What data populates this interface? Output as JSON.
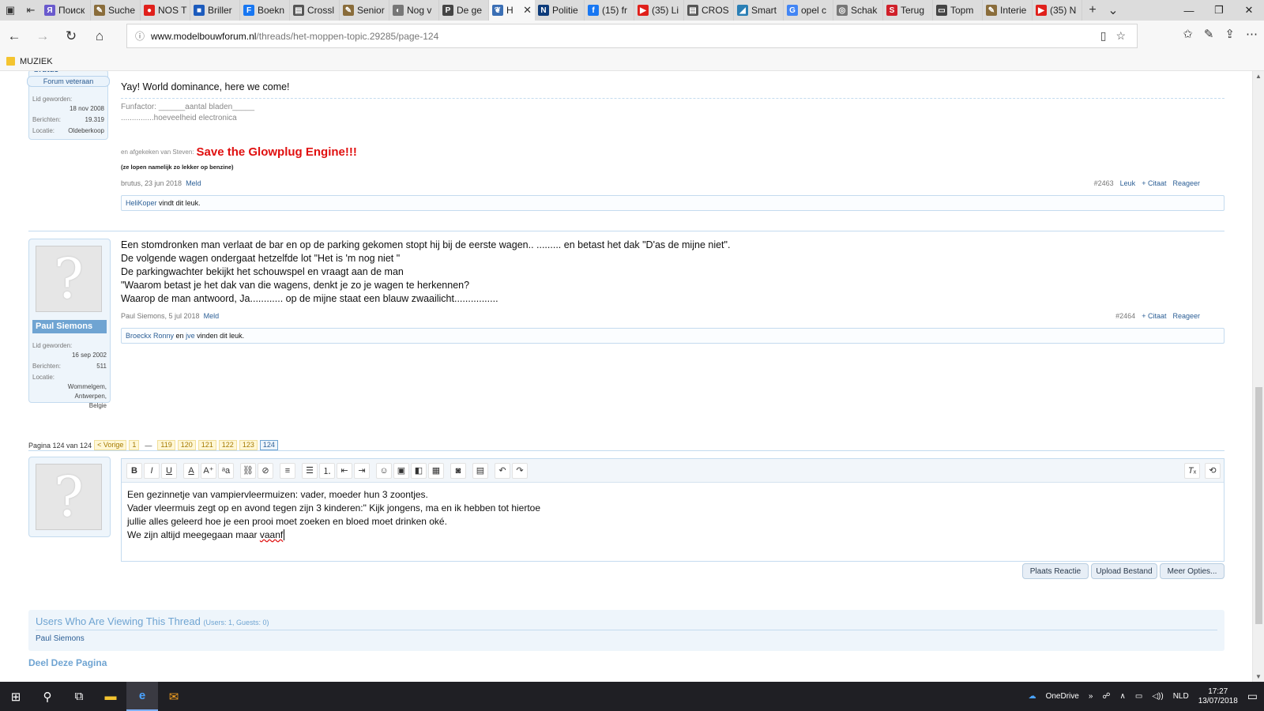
{
  "browser": {
    "tabs": [
      {
        "label": "Поиск",
        "color": "#6a5acd",
        "icon": "Я"
      },
      {
        "label": "Suche",
        "color": "#8a6d3b",
        "icon": "✎"
      },
      {
        "label": "NOS T",
        "color": "#e0201b",
        "icon": "●"
      },
      {
        "label": "Briller",
        "color": "#1c5bbd",
        "icon": "■"
      },
      {
        "label": "Boekn",
        "color": "#1877f2",
        "icon": "F"
      },
      {
        "label": "Crossl",
        "color": "#555555",
        "icon": "▤"
      },
      {
        "label": "Senior",
        "color": "#8a6d3b",
        "icon": "✎"
      },
      {
        "label": "Nog v",
        "color": "#777777",
        "icon": "◐"
      },
      {
        "label": "De ge",
        "color": "#444444",
        "icon": "P"
      },
      {
        "label": "H",
        "color": "#3b6fb5",
        "icon": "❦"
      },
      {
        "label": "Politie",
        "color": "#0d3b7a",
        "icon": "N"
      },
      {
        "label": "(15) fr",
        "color": "#1877f2",
        "icon": "f"
      },
      {
        "label": "(35) Li",
        "color": "#e0201b",
        "icon": "▶"
      },
      {
        "label": "CROS",
        "color": "#555555",
        "icon": "▤"
      },
      {
        "label": "Smart",
        "color": "#2a7fb5",
        "icon": "◢"
      },
      {
        "label": "opel c",
        "color": "#4285f4",
        "icon": "G"
      },
      {
        "label": "Schak",
        "color": "#777777",
        "icon": "◎"
      },
      {
        "label": "Terug",
        "color": "#d0202a",
        "icon": "S"
      },
      {
        "label": "Topm",
        "color": "#444444",
        "icon": "▭"
      },
      {
        "label": "Interie",
        "color": "#8a6d3b",
        "icon": "✎"
      },
      {
        "label": "(35) N",
        "color": "#e0201b",
        "icon": "▶"
      }
    ],
    "active_tab_index": 9,
    "url_domain": "www.modelbouwforum.nl",
    "url_path": "/threads/het-moppen-topic.29285/page-124",
    "favorites": [
      {
        "label": "MUZIEK"
      }
    ]
  },
  "post1": {
    "username_partial": "brutus",
    "role": "Forum veteraan",
    "stats": [
      {
        "label": "Lid geworden:",
        "value": "18 nov 2008"
      },
      {
        "label": "Berichten:",
        "value": "19.319"
      },
      {
        "label": "Locatie:",
        "value": "Oldeberkoop"
      }
    ],
    "message": "Yay! World dominance, here we come!",
    "signature": {
      "funfactor_label": "Funfactor:",
      "funfactor_value": "______aantal bladen_____",
      "funfactor_line2": "...............hoeveelheid electronica",
      "stolen_from": "en afgekeken van Steven:",
      "glowplug": "Save the Glowplug Engine!!!",
      "benzine": "(ze lopen namelijk zo lekker op benzine)"
    },
    "meta_author_date": "brutus, 23 jun 2018",
    "report": "Meld",
    "post_number": "#2463",
    "like": "Leuk",
    "quote": "+ Citaat",
    "reply": "Reageer",
    "liked_by": "HeliKoper",
    "liked_suffix": "vindt dit leuk."
  },
  "post2": {
    "username": "Paul Siemons",
    "stats": [
      {
        "label": "Lid geworden:",
        "value": "16 sep 2002"
      },
      {
        "label": "Berichten:",
        "value": "511"
      },
      {
        "label": "Locatie:",
        "value": "Wommelgem, Antwerpen, Belgie"
      }
    ],
    "lines": [
      "Een stomdronken man verlaat de bar en op de parking gekomen stopt hij bij de eerste wagen.. ......... en betast het dak \"D'as de mijne niet\".",
      "De volgende wagen ondergaat hetzelfde lot \"Het is 'm nog niet \"",
      "De parkingwachter bekijkt het schouwspel en vraagt aan de man",
      "\"Waarom betast je het dak van die wagens, denkt je zo je wagen te herkennen?",
      "Waarop de man antwoord, Ja............ op de mijne staat een blauw zwaailicht................"
    ],
    "meta_author_date": "Paul Siemons, 5 jul 2018",
    "report": "Meld",
    "post_number": "#2464",
    "quote": "+ Citaat",
    "reply": "Reageer",
    "liked_by_1": "Broeckx Ronny",
    "liked_and": "en",
    "liked_by_2": "jve",
    "liked_suffix": "vinden dit leuk."
  },
  "pagination": {
    "label": "Pagina 124 van 124",
    "prev": "< Vorige",
    "first": "1",
    "ellipsis": "—",
    "pages": [
      "119",
      "120",
      "121",
      "122",
      "123"
    ],
    "current": "124"
  },
  "editor": {
    "lines": [
      "Een gezinnetje van vampiervleermuizen: vader, moeder hun 3 zoontjes.",
      "Vader vleermuis zegt op en avond tegen zijn 3 kinderen:\" Kijk jongens, ma en ik hebben tot hiertoe",
      "jullie alles geleerd hoe je een prooi moet zoeken en bloed moet drinken oké."
    ],
    "last_line_prefix": "We zijn altijd meegegaan maar",
    "last_line_misspelled": "vaanf"
  },
  "buttons": {
    "submit": "Plaats Reactie",
    "upload": "Upload Bestand",
    "more": "Meer Opties..."
  },
  "viewers": {
    "title": "Users Who Are Viewing This Thread",
    "counts": "(Users: 1, Guests: 0)",
    "names": "Paul Siemons"
  },
  "share_title": "Deel Deze Pagina",
  "taskbar": {
    "onedrive": "OneDrive",
    "lang": "NLD",
    "time": "17:27",
    "date": "13/07/2018"
  }
}
